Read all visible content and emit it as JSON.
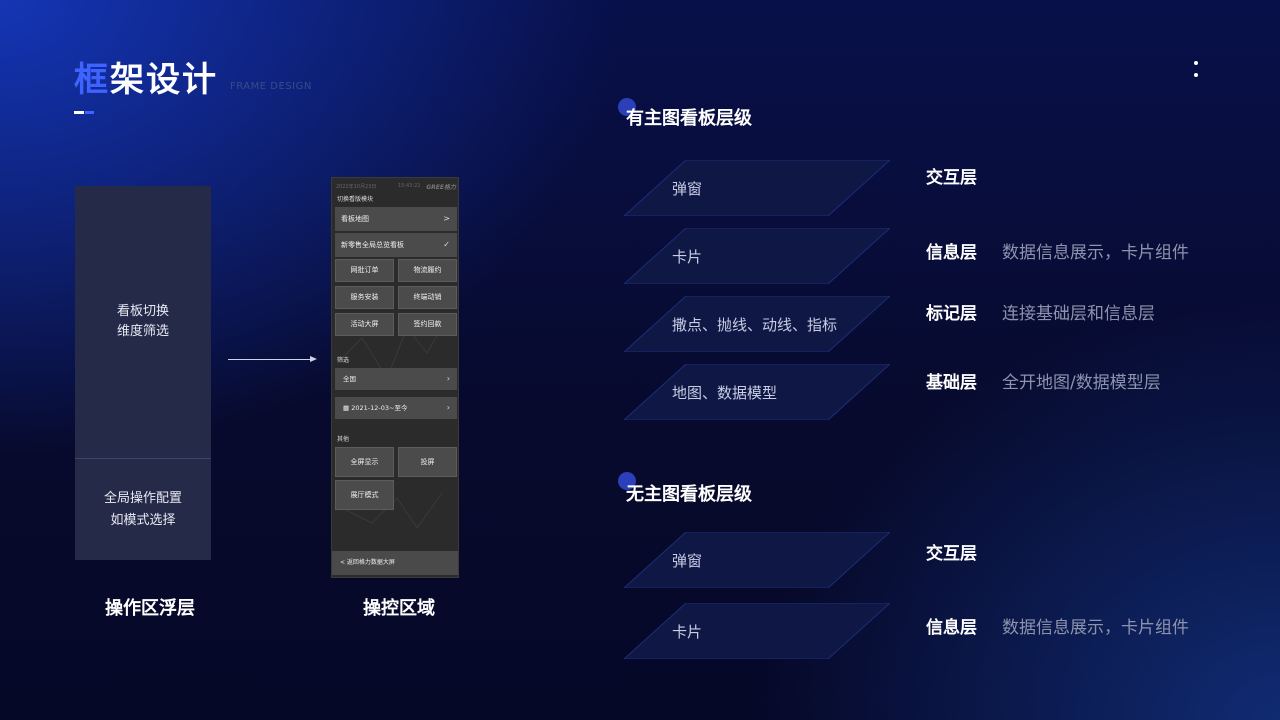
{
  "header": {
    "title_accent": "框",
    "title_rest": "架设计",
    "subtitle": "FRAME DESIGN"
  },
  "left_panel": {
    "top_line1": "看板切换",
    "top_line2": "维度筛选",
    "bottom_line1": "全局操作配置",
    "bottom_line2": "如模式选择",
    "caption": "操作区浮层"
  },
  "phone": {
    "caption": "操控区域",
    "status_date": "2022年10月23日",
    "status_time": "15:43:22",
    "brand": "GREE格力",
    "section_switch": "切换看版模块",
    "rows": [
      {
        "label": "看板地图",
        "right": ">"
      },
      {
        "label": "新零售全局总览看板",
        "right": "✓"
      }
    ],
    "buttons": [
      "网批订单",
      "物流履约",
      "服务安装",
      "终端动销",
      "活动大屏",
      "签约回款"
    ],
    "section_filter": "筛选",
    "filter_region": "全国",
    "filter_date": "2021-12-03~至今",
    "section_other": "其他",
    "other_buttons": [
      "全屏显示",
      "投屏",
      "展厅模式"
    ],
    "back": "< 返回格力数据大屏"
  },
  "section_with_map": {
    "title": "有主图看板层级",
    "layers": [
      {
        "box": "弹窗",
        "name": "交互层",
        "desc": ""
      },
      {
        "box": "卡片",
        "name": "信息层",
        "desc": "数据信息展示，卡片组件"
      },
      {
        "box": "撒点、抛线、动线、指标",
        "name": "标记层",
        "desc": "连接基础层和信息层"
      },
      {
        "box": "地图、数据模型",
        "name": "基础层",
        "desc": "全开地图/数据模型层"
      }
    ]
  },
  "section_without_map": {
    "title": "无主图看板层级",
    "layers": [
      {
        "box": "弹窗",
        "name": "交互层",
        "desc": ""
      },
      {
        "box": "卡片",
        "name": "信息层",
        "desc": "数据信息展示，卡片组件"
      }
    ]
  },
  "colors": {
    "accent": "#3f63ff",
    "background": "#070a2c",
    "panel": "#262a49",
    "layer_fill": "#0f1745",
    "layer_border": "#1e2d78"
  }
}
